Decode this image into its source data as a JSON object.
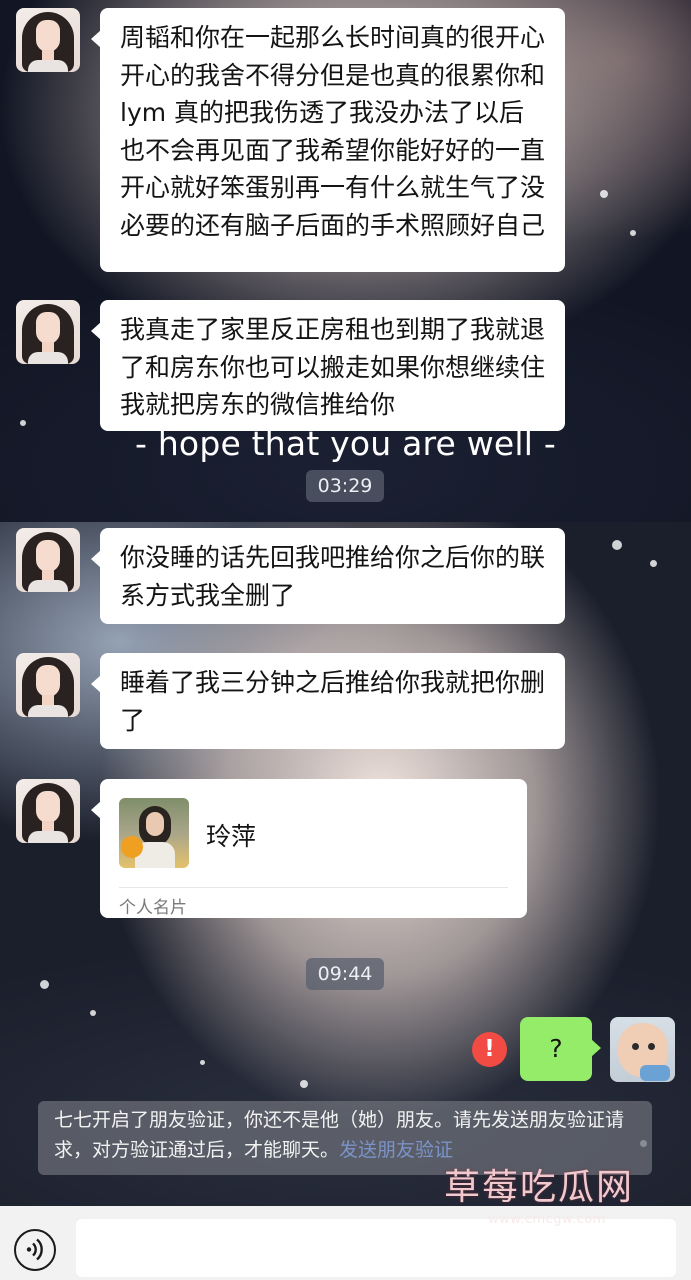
{
  "messages": [
    {
      "text": "周韬和你在一起那么长时间真的很开心开心的我舍不得分但是也真的很累你和 lym 真的把我伤透了我没办法了以后也不会再见面了我希望你能好好的一直开心就好笨蛋别再一有什么就生气了没必要的还有脑子后面的手术照顾好自己"
    },
    {
      "text": "我真走了家里反正房租也到期了我就退了和房东你也可以搬走如果你想继续住我就把房东的微信推给你"
    },
    {
      "text": "你没睡的话先回我吧推给你之后你的联系方式我全删了"
    },
    {
      "text": "睡着了我三分钟之后推给你我就把你删了"
    }
  ],
  "caption": "- hope that you are well -",
  "timestamps": [
    "03:29",
    "09:44"
  ],
  "contact_card": {
    "name": "玲萍",
    "label": "个人名片"
  },
  "my_message": {
    "text": "?",
    "error_icon": "!"
  },
  "notice": {
    "text": "七七开启了朋友验证，你还不是他（她）朋友。请先发送朋友验证请求，对方验证通过后，才能聊天。",
    "link": "发送朋友验证"
  },
  "watermark": {
    "title": "草莓吃瓜网",
    "url": "www.cmcgw.com"
  },
  "icons": {
    "voice": "voice-icon",
    "error": "error-icon"
  }
}
